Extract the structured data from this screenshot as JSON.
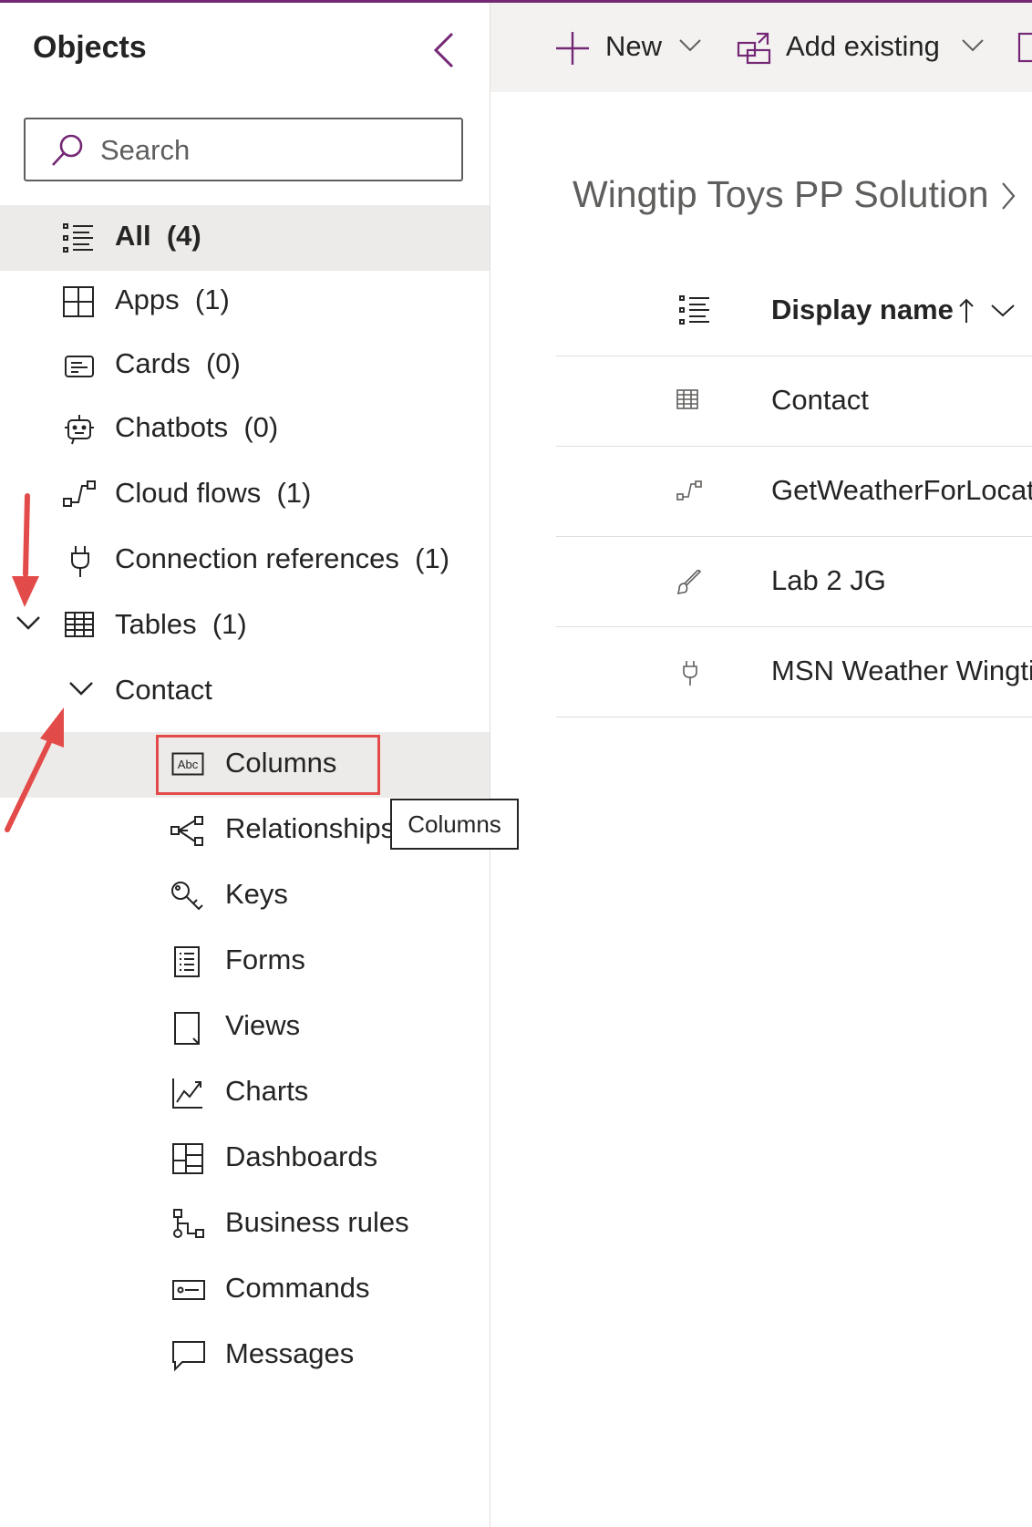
{
  "objects_pane": {
    "title": "Objects",
    "search_placeholder": "Search",
    "items": [
      {
        "label": "All",
        "count": "(4)",
        "icon": "all-list-icon"
      },
      {
        "label": "Apps",
        "count": "(1)",
        "icon": "apps-icon"
      },
      {
        "label": "Cards",
        "count": "(0)",
        "icon": "cards-icon"
      },
      {
        "label": "Chatbots",
        "count": "(0)",
        "icon": "chatbot-icon"
      },
      {
        "label": "Cloud flows",
        "count": "(1)",
        "icon": "cloud-flow-icon"
      },
      {
        "label": "Connection references",
        "count": "(1)",
        "icon": "plug-icon"
      },
      {
        "label": "Tables",
        "count": "(1)",
        "icon": "table-icon"
      },
      {
        "label": "Contact",
        "count": "",
        "icon": "chevron-down-icon"
      }
    ],
    "contact_children": [
      {
        "label": "Columns",
        "icon": "abc-icon"
      },
      {
        "label": "Relationships",
        "icon": "relationships-icon"
      },
      {
        "label": "Keys",
        "icon": "keys-icon"
      },
      {
        "label": "Forms",
        "icon": "forms-icon"
      },
      {
        "label": "Views",
        "icon": "views-icon"
      },
      {
        "label": "Charts",
        "icon": "chart-icon"
      },
      {
        "label": "Dashboards",
        "icon": "dashboard-icon"
      },
      {
        "label": "Business rules",
        "icon": "business-rules-icon"
      },
      {
        "label": "Commands",
        "icon": "commands-icon"
      },
      {
        "label": "Messages",
        "icon": "message-icon"
      }
    ],
    "tooltip": "Columns"
  },
  "toolbar": {
    "new_label": "New",
    "add_existing_label": "Add existing"
  },
  "breadcrumb": {
    "solution": "Wingtip Toys PP Solution"
  },
  "grid": {
    "header_label": "Display name",
    "rows": [
      {
        "name": "Contact",
        "icon": "table-icon"
      },
      {
        "name": "GetWeatherForLocation",
        "icon": "cloud-flow-icon"
      },
      {
        "name": "Lab 2 JG",
        "icon": "brush-icon"
      },
      {
        "name": "MSN Weather Wingtip",
        "icon": "plug-icon"
      }
    ]
  },
  "colors": {
    "accent_purple": "#742774",
    "annotation_red": "#e34b4b",
    "selected_row": "#edebe9",
    "toolbar_bg": "#f3f2f1"
  }
}
